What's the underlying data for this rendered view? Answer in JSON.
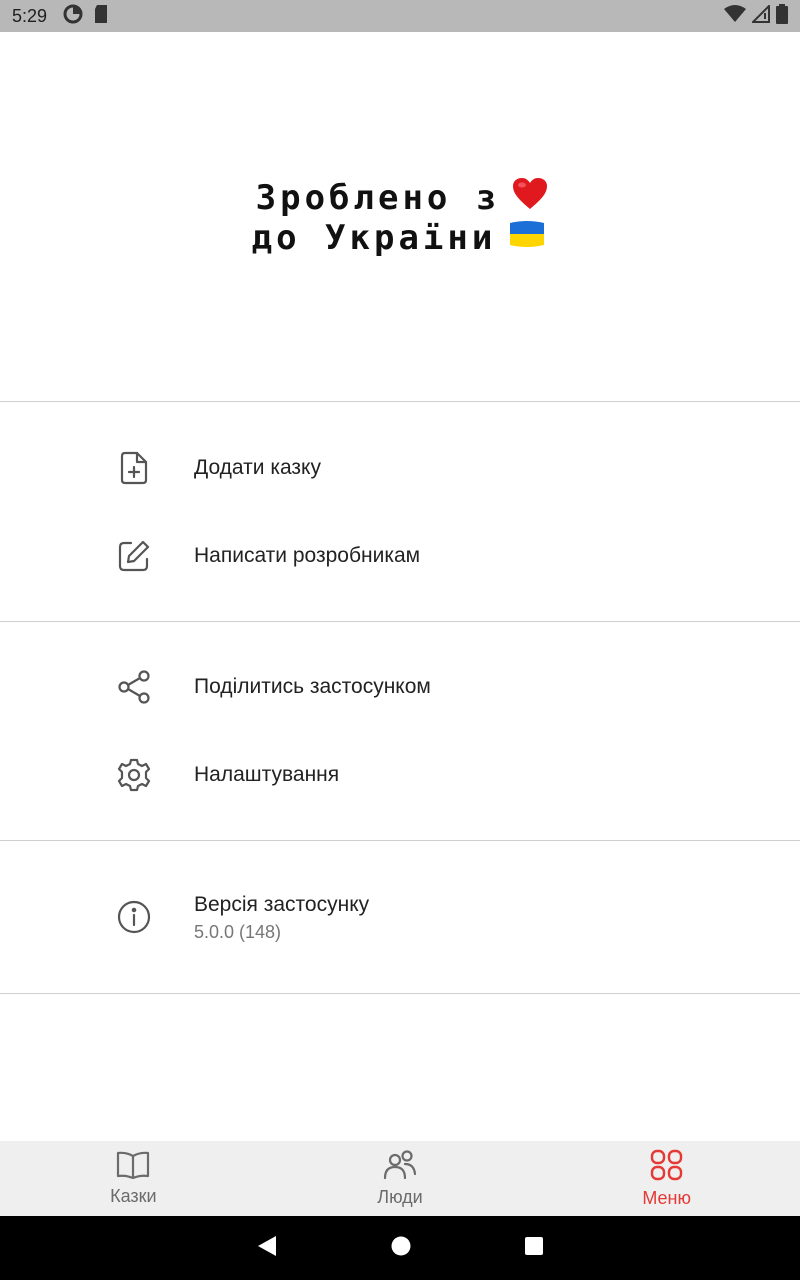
{
  "status_bar": {
    "time": "5:29",
    "left_icons": [
      "data-saver-icon",
      "sd-card-icon"
    ],
    "right_icons": [
      "wifi-icon",
      "signal-icon",
      "battery-icon"
    ]
  },
  "header": {
    "line1": "Зроблено з",
    "line1_emoji": "❤️",
    "line2": "до України",
    "line2_emoji": "🇺🇦"
  },
  "menu": {
    "section1": [
      {
        "icon": "add-file-icon",
        "label": "Додати казку"
      },
      {
        "icon": "edit-icon",
        "label": "Написати розробникам"
      }
    ],
    "section2": [
      {
        "icon": "share-icon",
        "label": "Поділитись застосунком"
      },
      {
        "icon": "gear-icon",
        "label": "Налаштування"
      }
    ],
    "section3": [
      {
        "icon": "info-icon",
        "label": "Версія застосунку",
        "sub": "5.0.0 (148)"
      }
    ]
  },
  "bottom_nav": {
    "items": [
      {
        "icon": "book-icon",
        "label": "Казки",
        "active": false
      },
      {
        "icon": "people-icon",
        "label": "Люди",
        "active": false
      },
      {
        "icon": "grid-icon",
        "label": "Меню",
        "active": true
      }
    ],
    "active_color": "#e53935",
    "inactive_color": "#6b6b6b"
  },
  "system_nav": [
    "back-icon",
    "home-icon",
    "recents-icon"
  ]
}
